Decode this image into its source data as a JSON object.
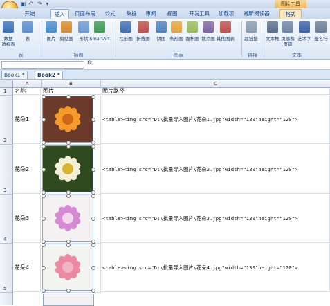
{
  "titlebar": {
    "picture_tools": "图片工具"
  },
  "tabs": [
    {
      "label": "开始"
    },
    {
      "label": "插入"
    },
    {
      "label": "页面布局"
    },
    {
      "label": "公式"
    },
    {
      "label": "数据"
    },
    {
      "label": "审阅"
    },
    {
      "label": "视图"
    },
    {
      "label": "开发工具"
    },
    {
      "label": "加载项"
    },
    {
      "label": "福昕阅读器"
    },
    {
      "label": "格式"
    }
  ],
  "ribbon": {
    "buttons": [
      {
        "label": "数据\n透视表",
        "icon": "pivot-icon",
        "color": "#3b73b9"
      },
      {
        "label": "表",
        "icon": "table-icon",
        "color": "#5a8fd1"
      },
      {
        "label": "图片",
        "icon": "picture-icon",
        "color": "#4b8dcf"
      },
      {
        "label": "剪贴画",
        "icon": "clipart-icon",
        "color": "#d98a2b"
      },
      {
        "label": "形状",
        "icon": "shapes-icon",
        "color": "#6b9bd1"
      },
      {
        "label": "SmartArt",
        "icon": "smartart-icon",
        "color": "#3e9b54"
      },
      {
        "label": "柱形图",
        "icon": "column-chart-icon",
        "color": "#3f6fb5"
      },
      {
        "label": "折线图",
        "icon": "line-chart-icon",
        "color": "#c0504d"
      },
      {
        "label": "饼图",
        "icon": "pie-chart-icon",
        "color": "#4f81bd"
      },
      {
        "label": "条形图",
        "icon": "bar-chart-icon",
        "color": "#e7a23b"
      },
      {
        "label": "面积图",
        "icon": "area-chart-icon",
        "color": "#9bbb59"
      },
      {
        "label": "散点图",
        "icon": "scatter-chart-icon",
        "color": "#8064a2"
      },
      {
        "label": "其他图表",
        "icon": "other-chart-icon",
        "color": "#c0504d"
      },
      {
        "label": "超链接",
        "icon": "hyperlink-icon",
        "color": "#8a9bb0"
      },
      {
        "label": "文本框",
        "icon": "textbox-icon",
        "color": "#5a6f8e"
      },
      {
        "label": "页眉和\n页脚",
        "icon": "header-footer-icon",
        "color": "#6f84a3"
      },
      {
        "label": "艺术字",
        "icon": "wordart-icon",
        "color": "#3a62a8"
      },
      {
        "label": "签名行",
        "icon": "signature-icon",
        "color": "#6d7e99"
      }
    ],
    "groups": [
      {
        "label": "表"
      },
      {
        "label": "插图"
      },
      {
        "label": "图表"
      },
      {
        "label": "链接"
      },
      {
        "label": "文本"
      }
    ]
  },
  "formula_bar": {
    "fx": "fx"
  },
  "workbooks": [
    {
      "label": "Book1 *"
    },
    {
      "label": "Book2 *"
    }
  ],
  "sheet": {
    "columns": [
      "A",
      "B",
      "C"
    ],
    "header_row": {
      "row": "1",
      "a": "名称",
      "b": "图片",
      "c": "图片路径"
    },
    "rows": [
      {
        "row": "2",
        "name": "花朵1",
        "path": "<table><img src=\"D:\\批量导入图片\\花朵1.jpg\"width=\"130\"height=\"120\">"
      },
      {
        "row": "3",
        "name": "花朵2",
        "path": "<table><img src=\"D:\\批量导入图片\\花朵2.jpg\"width=\"130\"height=\"120\">"
      },
      {
        "row": "4",
        "name": "花朵3",
        "path": "<table><img src=\"D:\\批量导入图片\\花朵3.jpg\"width=\"130\"height=\"120\">"
      },
      {
        "row": "5",
        "name": "花朵4",
        "path": "<table><img src=\"D:\\批量导入图片\\花朵4.jpg\"width=\"130\"height=\"120\">"
      }
    ]
  }
}
